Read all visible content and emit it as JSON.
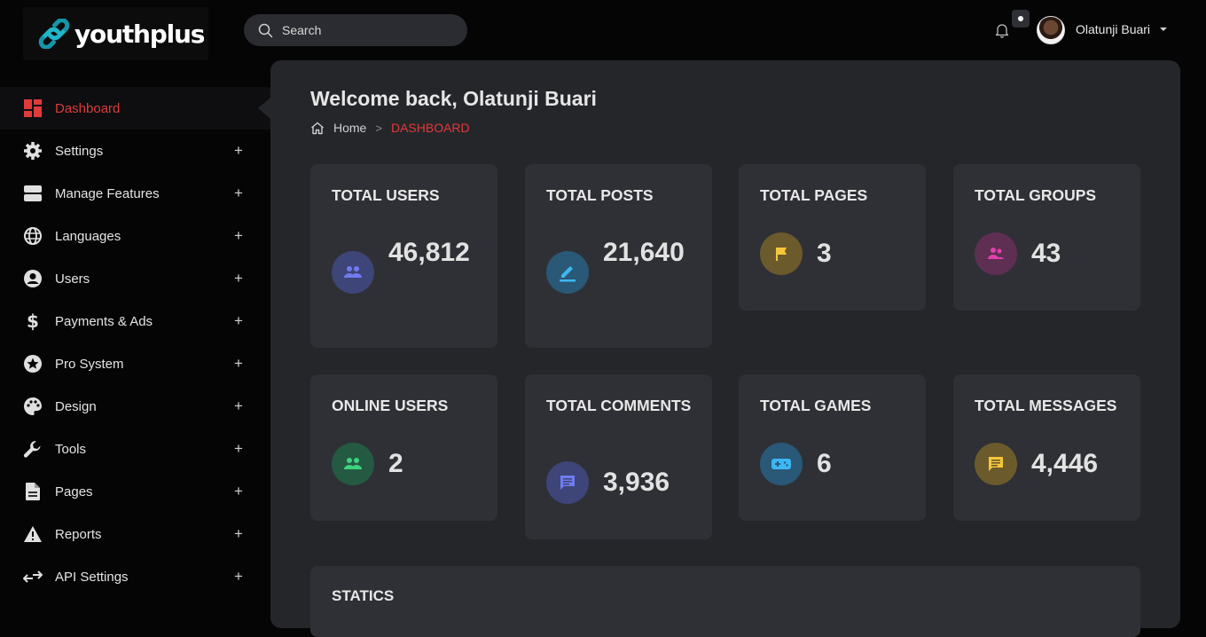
{
  "brand": {
    "name": "youthplus"
  },
  "search": {
    "label": "Search"
  },
  "user": {
    "name": "Olatunji Buari"
  },
  "sidebar": {
    "items": [
      {
        "label": "Dashboard",
        "icon": "dashboard-icon",
        "active": true
      },
      {
        "label": "Settings",
        "icon": "gear-icon",
        "expand": "+"
      },
      {
        "label": "Manage Features",
        "icon": "features-icon",
        "expand": "+"
      },
      {
        "label": "Languages",
        "icon": "globe-icon",
        "expand": "+"
      },
      {
        "label": "Users",
        "icon": "user-circle-icon",
        "expand": "+"
      },
      {
        "label": "Payments & Ads",
        "icon": "dollar-icon",
        "expand": "+"
      },
      {
        "label": "Pro System",
        "icon": "star-icon",
        "expand": "+"
      },
      {
        "label": "Design",
        "icon": "palette-icon",
        "expand": "+"
      },
      {
        "label": "Tools",
        "icon": "wrench-icon",
        "expand": "+"
      },
      {
        "label": "Pages",
        "icon": "document-icon",
        "expand": "+"
      },
      {
        "label": "Reports",
        "icon": "warning-icon",
        "expand": "+"
      },
      {
        "label": "API Settings",
        "icon": "api-arrows-icon",
        "expand": "+"
      }
    ]
  },
  "main": {
    "welcome": "Welcome back, Olatunji Buari",
    "breadcrumb": {
      "home": "Home",
      "separator": ">",
      "current": "DASHBOARD"
    },
    "cards": [
      {
        "title": "TOTAL USERS",
        "value": "46,812",
        "icon": "users-icon",
        "color": "#5c6bd9"
      },
      {
        "title": "TOTAL POSTS",
        "value": "21,640",
        "icon": "pencil-icon",
        "color": "#29a3e0"
      },
      {
        "title": "TOTAL PAGES",
        "value": "3",
        "icon": "flag-icon",
        "color": "#f0c030"
      },
      {
        "title": "TOTAL GROUPS",
        "value": "43",
        "icon": "group-icon",
        "color": "#d63aa0"
      },
      {
        "title": "ONLINE USERS",
        "value": "2",
        "icon": "online-users-icon",
        "color": "#2fbf71"
      },
      {
        "title": "TOTAL COMMENTS",
        "value": "3,936",
        "icon": "comment-icon",
        "color": "#5c6bd9"
      },
      {
        "title": "TOTAL GAMES",
        "value": "6",
        "icon": "gamepad-icon",
        "color": "#29a3e0"
      },
      {
        "title": "TOTAL MESSAGES",
        "value": "4,446",
        "icon": "message-icon",
        "color": "#f0c030"
      }
    ],
    "statics_title": "STATICS"
  },
  "colors": {
    "accent": "#e03a3a",
    "background": "#050506",
    "panel": "#25262a",
    "card": "#2f3036"
  }
}
